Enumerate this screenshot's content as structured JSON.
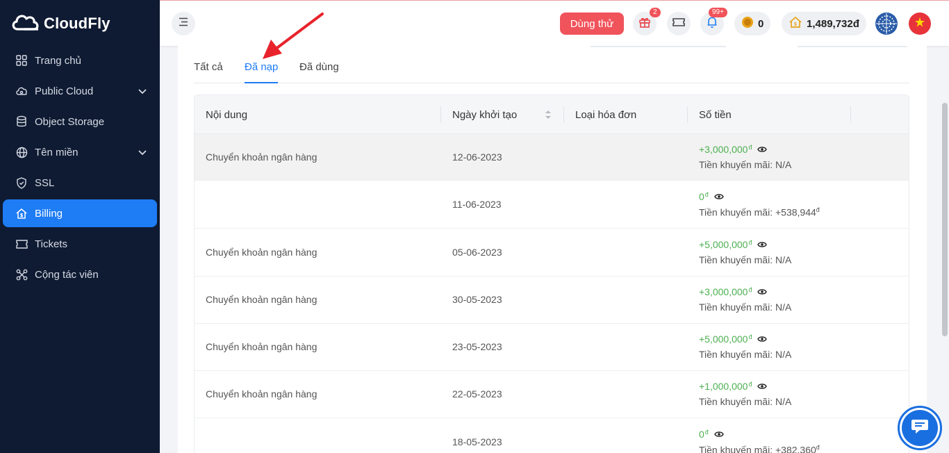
{
  "app": {
    "brand": "CloudFly"
  },
  "sidebar": {
    "items": [
      {
        "label": "Trang chủ",
        "icon": "grid-icon"
      },
      {
        "label": "Public Cloud",
        "icon": "cloud-icon"
      },
      {
        "label": "Object Storage",
        "icon": "database-icon"
      },
      {
        "label": "Tên miền",
        "icon": "globe-icon"
      },
      {
        "label": "SSL",
        "icon": "shield-icon"
      },
      {
        "label": "Billing",
        "icon": "billing-home-icon"
      },
      {
        "label": "Tickets",
        "icon": "ticket-icon"
      },
      {
        "label": "Cộng tác viên",
        "icon": "affiliate-icon"
      }
    ]
  },
  "header": {
    "trial_label": "Dùng thử",
    "gift_badge": "2",
    "notification_badge": "99+",
    "coins": "0",
    "balance": "1,489,732đ"
  },
  "tabs": [
    {
      "label": "Tất cả"
    },
    {
      "label": "Đã nạp"
    },
    {
      "label": "Đã dùng"
    }
  ],
  "table": {
    "columns": [
      "Nội dung",
      "Ngày khởi tạo",
      "Loại hóa đơn",
      "Số tiền"
    ],
    "currency_symbol": "đ",
    "promo_label": "Tiền khuyến mãi:",
    "rows": [
      {
        "content": "Chuyển khoản ngân hàng",
        "date": "12-06-2023",
        "type": "",
        "amount": "+3,000,000",
        "promo": "N/A"
      },
      {
        "content": "",
        "date": "11-06-2023",
        "type": "",
        "amount": "0",
        "promo": "+538,944"
      },
      {
        "content": "Chuyển khoản ngân hàng",
        "date": "05-06-2023",
        "type": "",
        "amount": "+5,000,000",
        "promo": "N/A"
      },
      {
        "content": "Chuyển khoản ngân hàng",
        "date": "30-05-2023",
        "type": "",
        "amount": "+3,000,000",
        "promo": "N/A"
      },
      {
        "content": "Chuyển khoản ngân hàng",
        "date": "23-05-2023",
        "type": "",
        "amount": "+5,000,000",
        "promo": "N/A"
      },
      {
        "content": "Chuyển khoản ngân hàng",
        "date": "22-05-2023",
        "type": "",
        "amount": "+1,000,000",
        "promo": "N/A"
      },
      {
        "content": "",
        "date": "18-05-2023",
        "type": "",
        "amount": "0",
        "promo": "+382,360"
      }
    ]
  },
  "colors": {
    "sidebar_bg": "#0f1b33",
    "accent": "#1e7cf5",
    "trial": "#f0535a",
    "amount_green": "#4caf50"
  }
}
